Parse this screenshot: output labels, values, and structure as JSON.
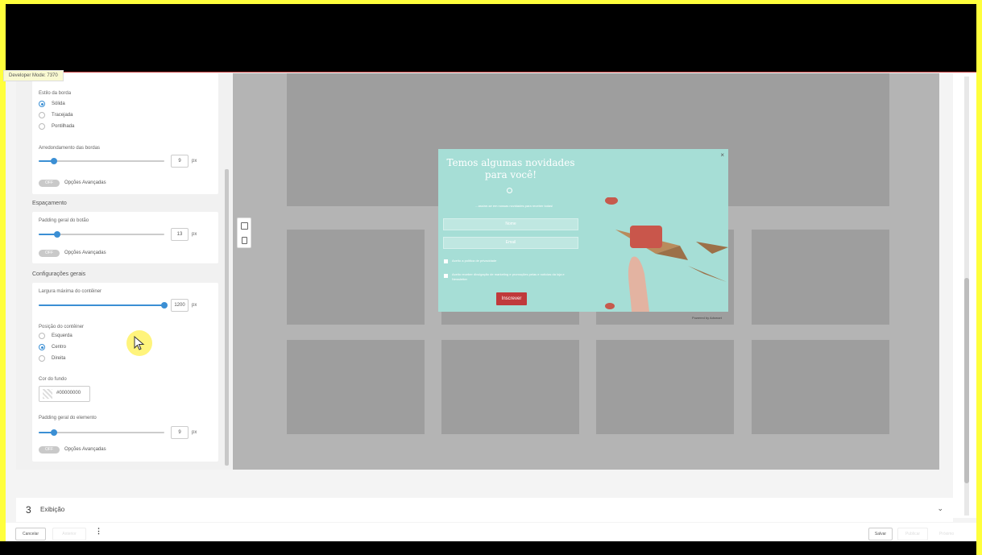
{
  "dev_badge": "Developer Mode: 7370",
  "border_style": {
    "label": "Estilo da borda",
    "options": [
      "Sólida",
      "Tracejada",
      "Pontilhada"
    ],
    "selected": "Sólida"
  },
  "border_radius": {
    "label": "Arredondamento das bordas",
    "value": "9",
    "unit": "px",
    "level": 0.12
  },
  "toggle_off": "OFF",
  "advanced_options": "Opções Avançadas",
  "spacing": {
    "title": "Espaçamento",
    "button_padding": {
      "label": "Padding geral do botão",
      "value": "13",
      "unit": "px",
      "level": 0.15
    }
  },
  "general": {
    "title": "Configurações gerais",
    "max_width": {
      "label": "Largura máxima do contêiner",
      "value": "1200",
      "unit": "px",
      "level": 1.0
    },
    "position": {
      "label": "Posição do contêiner",
      "options": [
        "Esquerda",
        "Centro",
        "Direita"
      ],
      "selected": "Centro"
    },
    "bg_color": {
      "label": "Cor do fundo",
      "value": "#00000000"
    },
    "element_padding": {
      "label": "Padding geral do elemento",
      "value": "9",
      "unit": "px",
      "level": 0.12
    }
  },
  "popup": {
    "title": "Temos algumas novidades para você!",
    "subtitle": "…assine-se em nossas novidades para receber todas!",
    "name_placeholder": "Nome",
    "email_placeholder": "Email",
    "consent1": "Aceito a política de privacidade",
    "consent2": "Aceito receber divulgação de marketing e promoções pelas e notícias da loja e Newsletter",
    "subscribe": "Inscrever",
    "close": "×",
    "powered": "Powered by Adsmart"
  },
  "step3": {
    "number": "3",
    "name": "Exibição"
  },
  "footer": {
    "cancel": "Cancelar",
    "previous": "Anterior",
    "save": "Salvar",
    "publish": "Publicar",
    "next": "Próximo"
  },
  "colors": {
    "accent": "#3b8fd4",
    "popup_bg": "#a6ded6",
    "subscribe_btn": "#c0393b",
    "highlight": "#ffff3c"
  }
}
